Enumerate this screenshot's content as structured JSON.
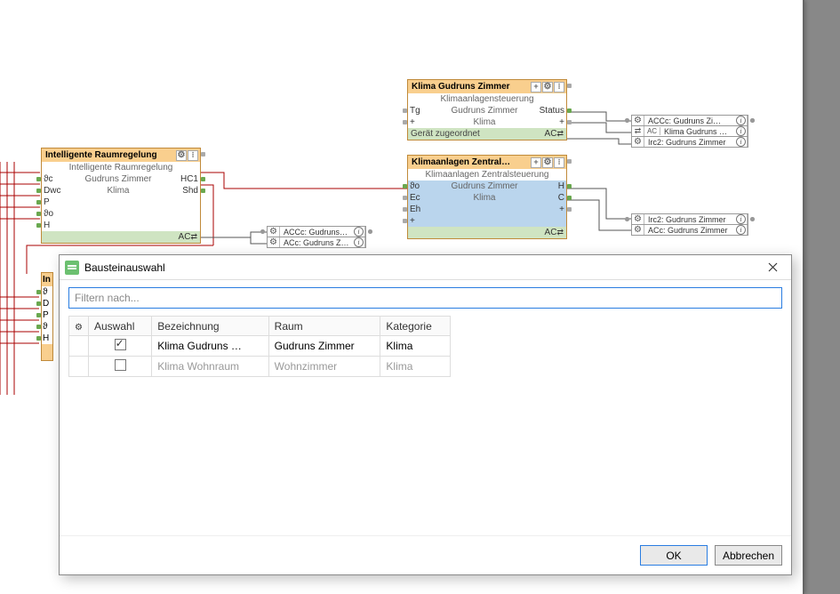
{
  "blocks": {
    "irc": {
      "title": "Intelligente Raumregelung",
      "subtitle": "Intelligente Raumregelung",
      "room": "Gudruns Zimmer",
      "category": "Klima",
      "inputs": [
        "ϑc",
        "Dwc",
        "P",
        "ϑo",
        "H"
      ],
      "outputs_row0": "HC1",
      "outputs_row1": "Shd",
      "foot_right": "AC",
      "refs": [
        {
          "icon": "gear",
          "text": "ACCc: Gudruns Zi…",
          "rinfo": true
        },
        {
          "icon": "gear",
          "text": "ACc: Gudruns Zim…",
          "rinfo": true
        }
      ]
    },
    "klima": {
      "title": "Klima Gudruns Zimmer",
      "subtitle": "Klimaanlagensteuerung",
      "room": "Gudruns Zimmer",
      "category": "Klima",
      "inL": "Tg",
      "outR": "Status",
      "foot_left": "Gerät zugeordnet",
      "foot_right": "AC"
    },
    "zentral": {
      "title": "Klimaanlagen Zentral…",
      "subtitle": "Klimaanlagen Zentralsteuerung",
      "room": "Gudruns Zimmer",
      "category": "Klima",
      "inputs": [
        "ϑo",
        "Ec",
        "Eh",
        "+"
      ],
      "outputs": [
        "H",
        "C",
        ""
      ],
      "foot_right": "AC"
    },
    "refs_top": [
      {
        "icon": "gear",
        "text": "ACCc: Gudruns Zi…"
      },
      {
        "icon": "swap",
        "text": "Klima Gudruns Zim…",
        "prefix": "AC"
      },
      {
        "icon": "gear",
        "text": "Irc2: Gudruns Zimmer"
      }
    ],
    "refs_bottom": [
      {
        "icon": "gear",
        "text": "Irc2: Gudruns Zimmer"
      },
      {
        "icon": "gear",
        "text": "ACc: Gudruns Zimmer"
      }
    ]
  },
  "dialog": {
    "title": "Bausteinauswahl",
    "filter_placeholder": "Filtern nach...",
    "columns": {
      "sel": "Auswahl",
      "name": "Bezeichnung",
      "room": "Raum",
      "cat": "Kategorie"
    },
    "rows": [
      {
        "checked": true,
        "name": "Klima Gudruns …",
        "room": "Gudruns Zimmer",
        "cat": "Klima",
        "disabled": false
      },
      {
        "checked": false,
        "name": "Klima Wohnraum",
        "room": "Wohnzimmer",
        "cat": "Klima",
        "disabled": true
      }
    ],
    "ok": "OK",
    "cancel": "Abbrechen"
  }
}
